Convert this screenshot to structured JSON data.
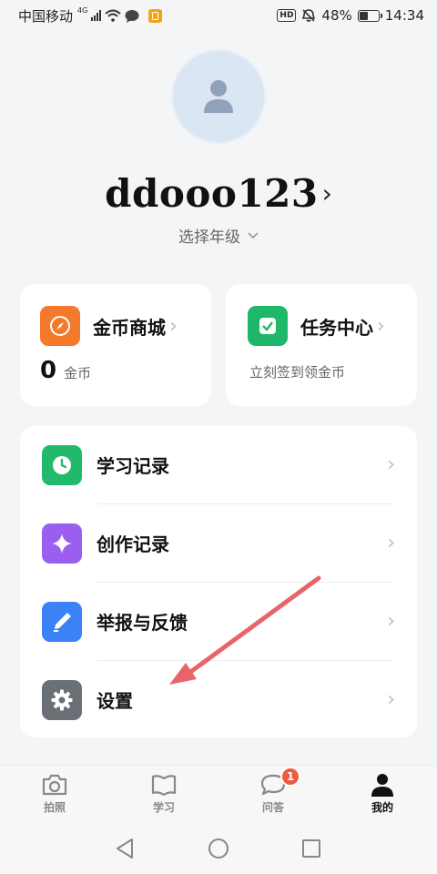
{
  "status_bar": {
    "carrier": "中国移动",
    "network": "4G",
    "hd": "HD",
    "battery_level": "48%",
    "battery_fraction": 0.48,
    "time": "14:34"
  },
  "profile": {
    "username": "ddooo123",
    "grade_selector": "选择年级"
  },
  "coin_card": {
    "title": "金币商城",
    "value": "0",
    "unit": "金币",
    "icon": "compass-icon",
    "color": "#f47a2b"
  },
  "task_card": {
    "title": "任务中心",
    "subtitle": "立刻签到领金币",
    "icon": "checkbox-icon",
    "color": "#1fb86a"
  },
  "menu": {
    "items": [
      {
        "label": "学习记录",
        "icon": "clock-icon",
        "color": "#22b96b"
      },
      {
        "label": "创作记录",
        "icon": "sparkle-icon",
        "color": "#9b5ff0"
      },
      {
        "label": "举报与反馈",
        "icon": "pen-icon",
        "color": "#3b82f6"
      },
      {
        "label": "设置",
        "icon": "gear-icon",
        "color": "#6b6f76"
      }
    ]
  },
  "tab_bar": {
    "tabs": [
      {
        "label": "拍照",
        "icon": "camera-icon"
      },
      {
        "label": "学习",
        "icon": "book-icon"
      },
      {
        "label": "问答",
        "icon": "chat-icon",
        "badge": "1"
      },
      {
        "label": "我的",
        "icon": "person-icon",
        "active": true
      }
    ]
  },
  "colors": {
    "annotation_arrow": "#e8646a",
    "badge": "#f05a3f"
  }
}
